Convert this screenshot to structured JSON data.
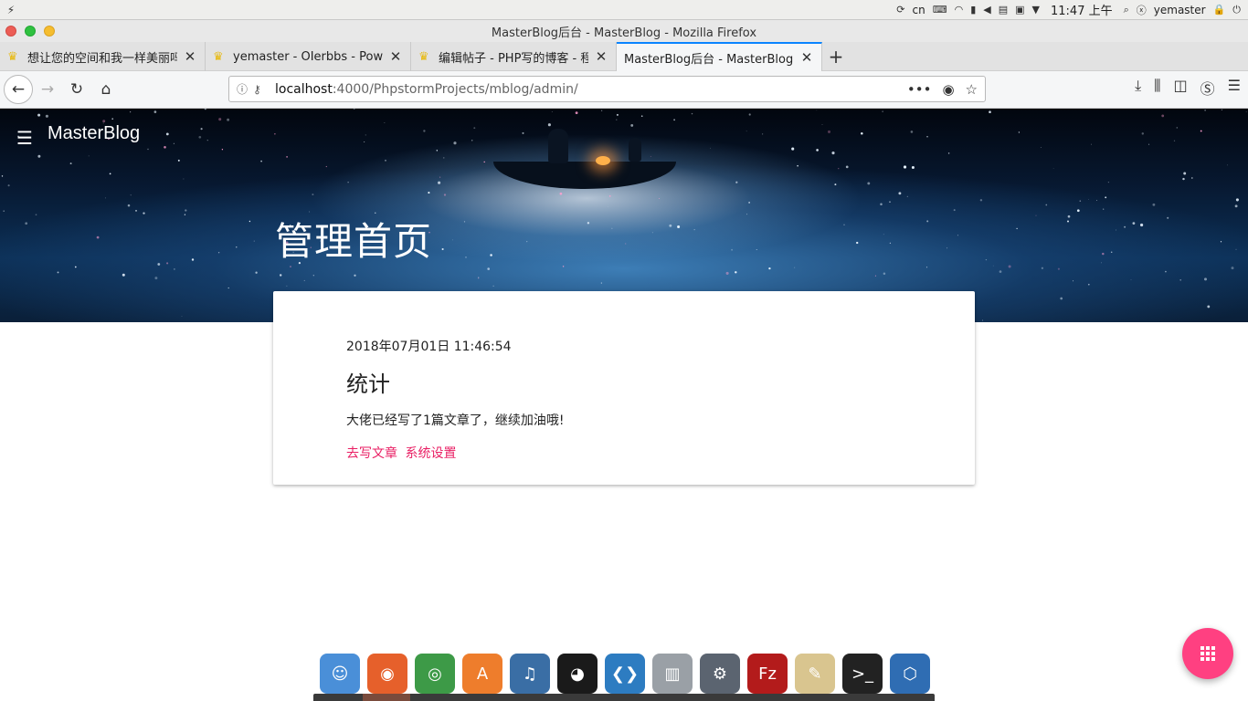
{
  "system_bar": {
    "input_method": "cn",
    "clock": "11:47 上午",
    "username": "yemaster"
  },
  "window": {
    "title": "MasterBlog后台 - MasterBlog - Mozilla Firefox"
  },
  "tabs": [
    {
      "label": "想让您的空间和我一样美丽吗",
      "active": false
    },
    {
      "label": "yemaster - OIerbbs - Powe",
      "active": false
    },
    {
      "label": "编辑帖子 - PHP写的博客 - 程",
      "active": false
    },
    {
      "label": "MasterBlog后台 - MasterBlog",
      "active": true
    }
  ],
  "address_bar": {
    "host": "localhost",
    "path": ":4000/PhpstormProjects/mblog/admin/"
  },
  "page": {
    "brand": "MasterBlog",
    "title": "管理首页",
    "card": {
      "date": "2018年07月01日 11:46:54",
      "heading": "统计",
      "stat": "大佬已经写了1篇文章了，继续加油哦!",
      "links": {
        "write": "去写文章",
        "settings": "系统设置"
      }
    }
  },
  "colors": {
    "accent_link": "#e91e63",
    "fab": "#ff4081"
  },
  "dock": [
    {
      "name": "finder",
      "color": "#4a8fd8"
    },
    {
      "name": "firefox",
      "color": "#e6602b"
    },
    {
      "name": "chrome",
      "color": "#3d9a47"
    },
    {
      "name": "app-store",
      "color": "#ee7d2c"
    },
    {
      "name": "music",
      "color": "#3a6ea5"
    },
    {
      "name": "qq",
      "color": "#1a1a1a"
    },
    {
      "name": "vscode",
      "color": "#2d7cc1"
    },
    {
      "name": "trash",
      "color": "#9aa0a6"
    },
    {
      "name": "system-settings",
      "color": "#5b6470"
    },
    {
      "name": "filezilla",
      "color": "#b31b1b"
    },
    {
      "name": "text-editor",
      "color": "#d9c58f"
    },
    {
      "name": "terminal",
      "color": "#222222"
    },
    {
      "name": "virtualbox",
      "color": "#2f6db3"
    }
  ]
}
